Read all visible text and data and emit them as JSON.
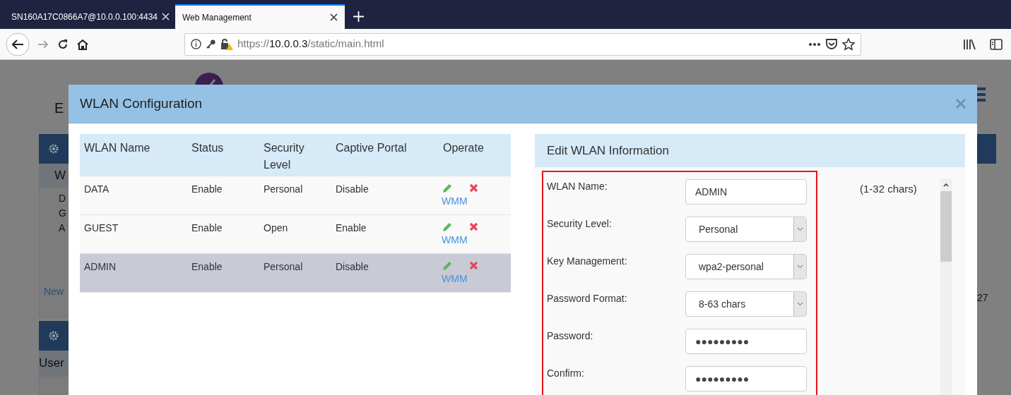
{
  "browser": {
    "tabs": [
      {
        "label": "SN160A17C0866A7@10.0.0.100:4434",
        "selected": false
      },
      {
        "label": "Web Management",
        "selected": true
      }
    ],
    "url": {
      "scheme": "https://",
      "host": "10.0.0.3",
      "path": "/static/main.html"
    }
  },
  "background": {
    "subtitle": "E",
    "panels": [
      {
        "heading": "W",
        "items": [
          "D",
          "G",
          "A"
        ],
        "link": "New"
      },
      {
        "heading": "User"
      }
    ],
    "right_text": "27"
  },
  "modal": {
    "title": "WLAN Configuration",
    "table": {
      "columns": [
        "WLAN Name",
        "Status",
        "Security Level",
        "Captive Portal",
        "Operate"
      ],
      "rows": [
        {
          "cells": [
            "DATA",
            "Enable",
            "Personal",
            "Disable"
          ],
          "link": "WMM",
          "selected": false
        },
        {
          "cells": [
            "GUEST",
            "Enable",
            "Open",
            "Enable"
          ],
          "link": "WMM",
          "selected": false
        },
        {
          "cells": [
            "ADMIN",
            "Enable",
            "Personal",
            "Disable"
          ],
          "link": "WMM",
          "selected": true
        }
      ]
    },
    "edit": {
      "title": "Edit WLAN Information",
      "hint": "(1-32 chars)",
      "fields": [
        {
          "label": "WLAN Name:",
          "kind": "text",
          "value": "ADMIN"
        },
        {
          "label": "Security Level:",
          "kind": "select",
          "value": "Personal"
        },
        {
          "label": "Key Management:",
          "kind": "select",
          "value": "wpa2-personal"
        },
        {
          "label": "Password Format:",
          "kind": "select",
          "value": "8-63 chars"
        },
        {
          "label": "Password:",
          "kind": "password",
          "value": "●●●●●●●●●"
        },
        {
          "label": "Confirm:",
          "kind": "password",
          "value": "●●●●●●●●●"
        }
      ]
    }
  }
}
